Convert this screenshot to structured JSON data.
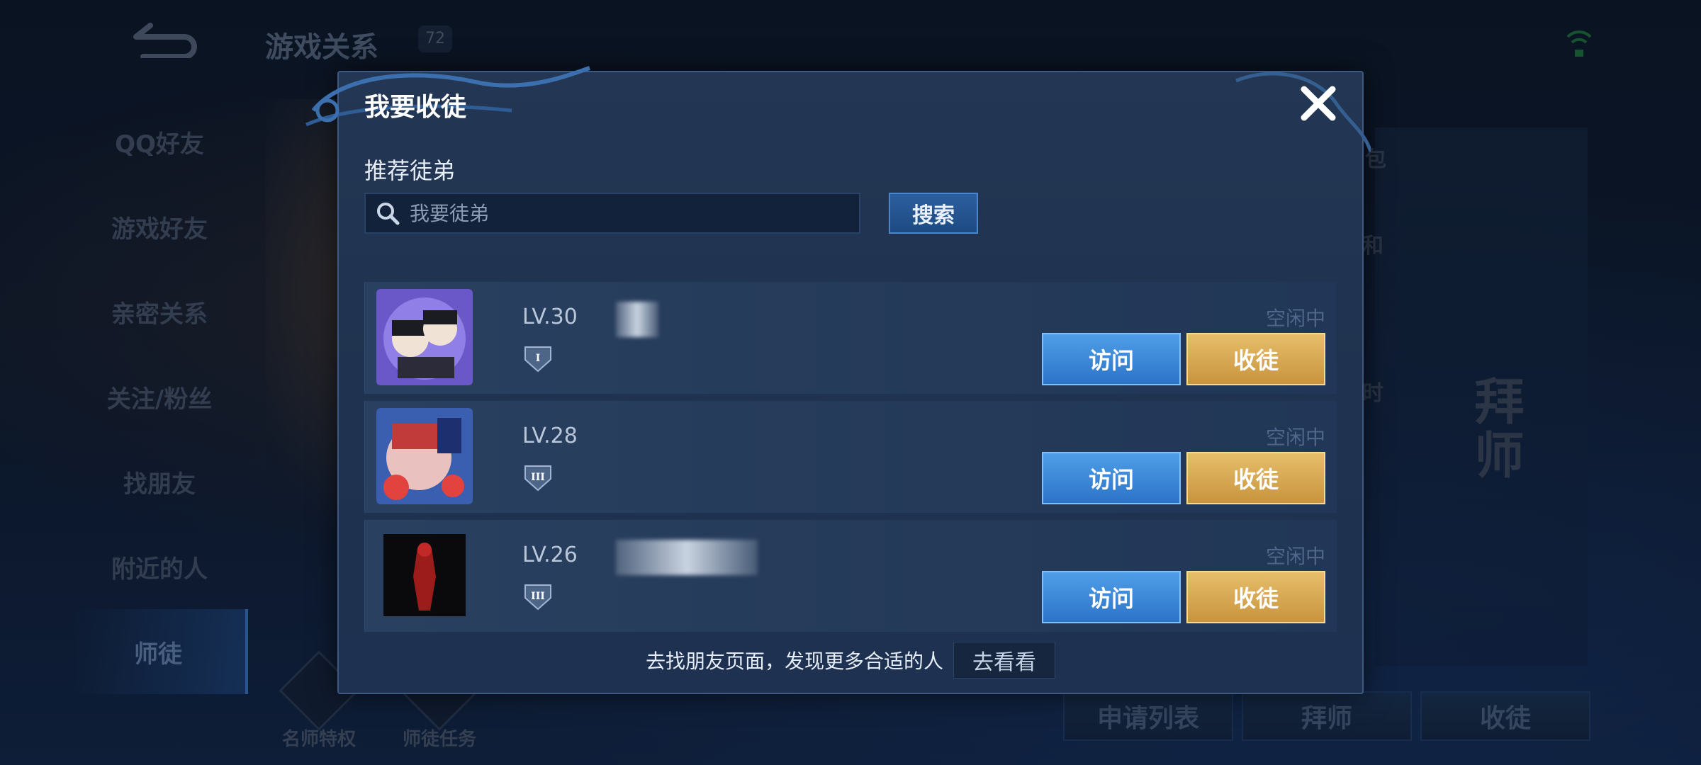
{
  "background": {
    "page_title": "游戏关系",
    "page_title_badge": "72",
    "sidebar": [
      {
        "label": "QQ好友"
      },
      {
        "label": "游戏好友"
      },
      {
        "label": "亲密关系"
      },
      {
        "label": "关注/粉丝"
      },
      {
        "label": "找朋友"
      },
      {
        "label": "附近的人"
      },
      {
        "label": "师徒",
        "active": true
      }
    ],
    "bottom_icons": [
      {
        "label": "名师特权"
      },
      {
        "label": "师徒任务"
      }
    ],
    "tabs": [
      "申请列表",
      "拜师",
      "收徒"
    ],
    "seal_text": "拜师",
    "edge_texts": [
      "包",
      "和",
      "时"
    ]
  },
  "modal": {
    "title": "我要收徒",
    "section_label": "推荐徒弟",
    "search": {
      "placeholder": "我要徒弟",
      "button_label": "搜索"
    },
    "rows": [
      {
        "level": "LV.30",
        "rank": "I",
        "status": "空闲中",
        "visit_label": "访问",
        "accept_label": "收徒"
      },
      {
        "level": "LV.28",
        "rank": "III",
        "status": "空闲中",
        "visit_label": "访问",
        "accept_label": "收徒"
      },
      {
        "level": "LV.26",
        "rank": "III",
        "status": "空闲中",
        "visit_label": "访问",
        "accept_label": "收徒"
      }
    ],
    "footer_text": "去找朋友页面，发现更多合适的人",
    "footer_button": "去看看"
  },
  "colors": {
    "visit_button": "#3b8ad8",
    "accept_button": "#d9a953",
    "modal_bg": "#213553"
  }
}
